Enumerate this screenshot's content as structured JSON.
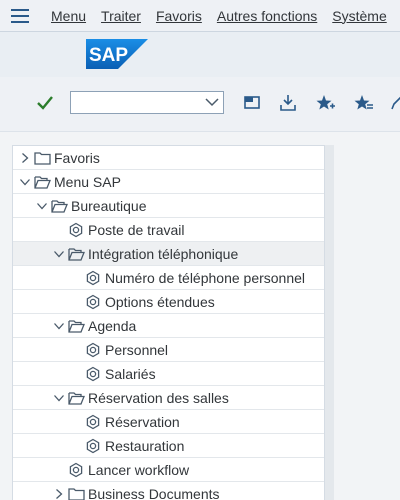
{
  "menubar": {
    "items": [
      {
        "label": "Menu"
      },
      {
        "label": "Traiter"
      },
      {
        "label": "Favoris"
      },
      {
        "label": "Autres fonctions"
      },
      {
        "label": "Système"
      }
    ]
  },
  "header": {
    "logo_text": "SAP"
  },
  "toolbar": {
    "command_field": {
      "value": "",
      "placeholder": ""
    }
  },
  "tree": [
    {
      "label": "Favoris",
      "level": 0,
      "type": "folder",
      "state": "collapsed"
    },
    {
      "label": "Menu SAP",
      "level": 0,
      "type": "folder",
      "state": "expanded"
    },
    {
      "label": "Bureautique",
      "level": 1,
      "type": "folder",
      "state": "expanded"
    },
    {
      "label": "Poste de travail",
      "level": 2,
      "type": "transaction"
    },
    {
      "label": "Intégration téléphonique",
      "level": 2,
      "type": "folder",
      "state": "expanded",
      "highlighted": true
    },
    {
      "label": "Numéro de téléphone personnel",
      "level": 3,
      "type": "transaction"
    },
    {
      "label": "Options étendues",
      "level": 3,
      "type": "transaction"
    },
    {
      "label": "Agenda",
      "level": 2,
      "type": "folder",
      "state": "expanded"
    },
    {
      "label": "Personnel",
      "level": 3,
      "type": "transaction"
    },
    {
      "label": "Salariés",
      "level": 3,
      "type": "transaction"
    },
    {
      "label": "Réservation des salles",
      "level": 2,
      "type": "folder",
      "state": "expanded"
    },
    {
      "label": "Réservation",
      "level": 3,
      "type": "transaction"
    },
    {
      "label": "Restauration",
      "level": 3,
      "type": "transaction"
    },
    {
      "label": "Lancer workflow",
      "level": 2,
      "type": "transaction"
    },
    {
      "label": "Business Documents",
      "level": 2,
      "type": "folder",
      "state": "collapsed"
    }
  ],
  "colors": {
    "accent": "#2a5a8a",
    "check": "#2b7d2b",
    "logo_blue": "#0a6ed1",
    "icon_gray": "#4a5a6a"
  }
}
